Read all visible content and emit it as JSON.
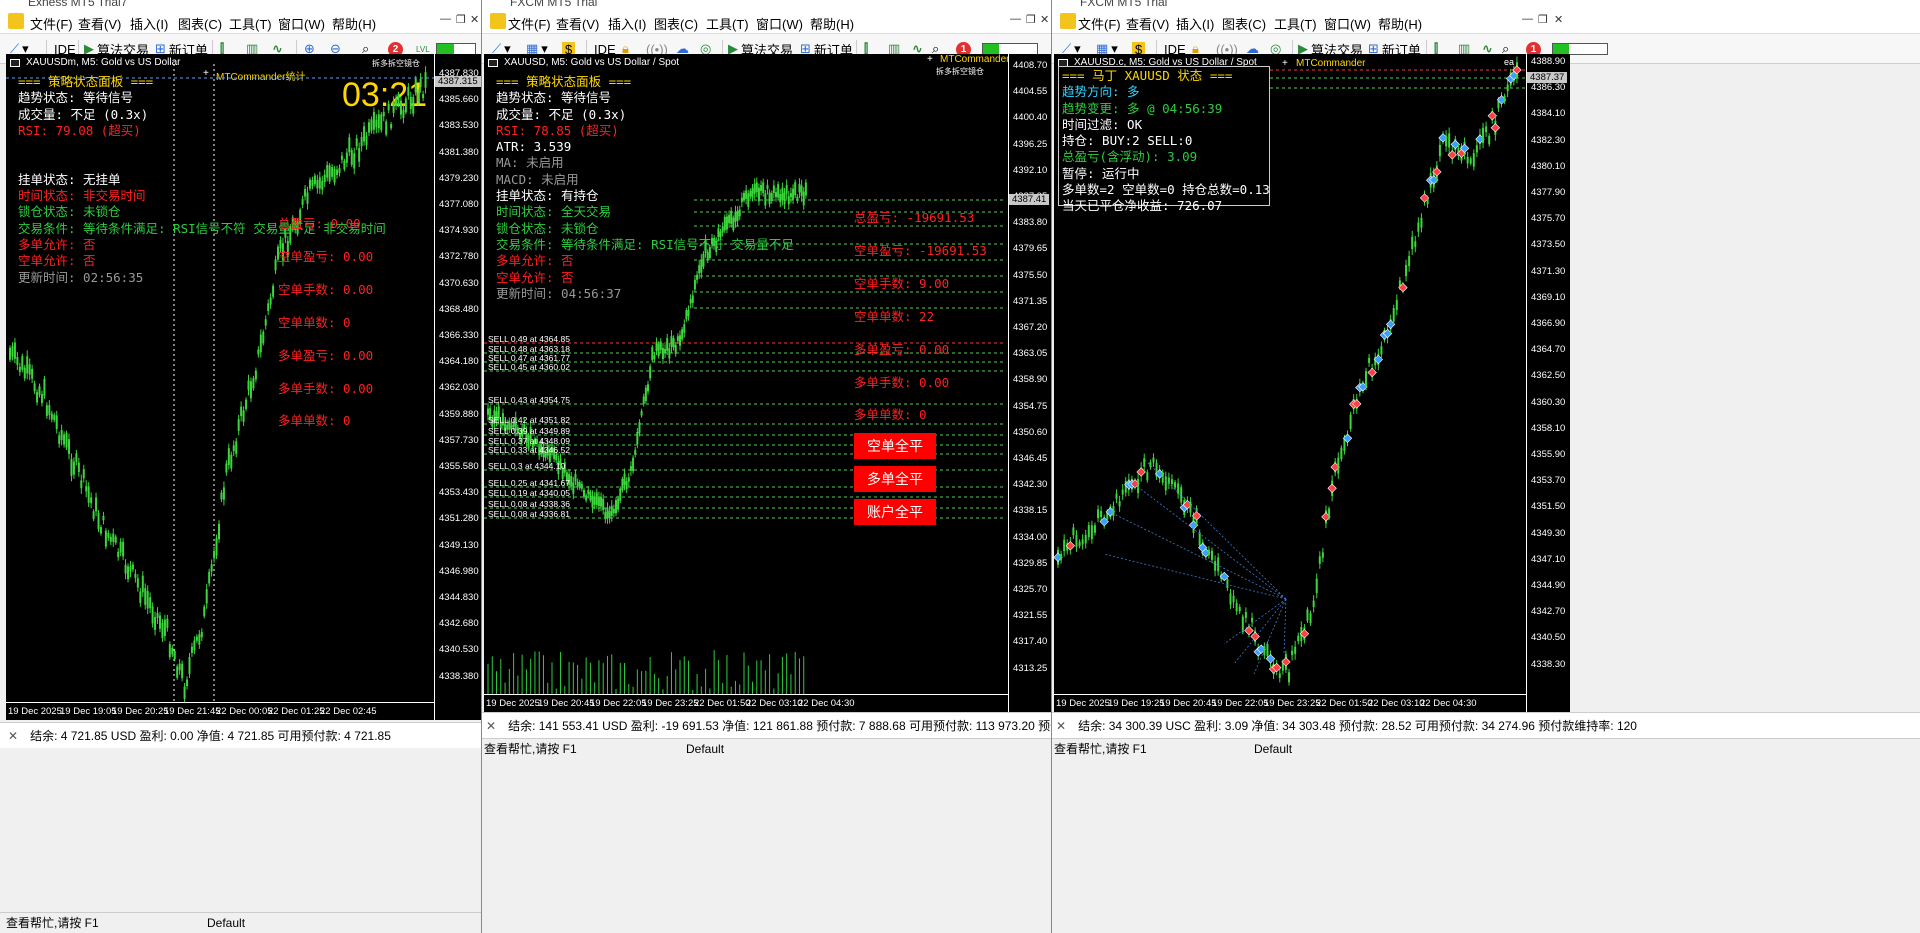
{
  "win1": {
    "title": "Exness MT5 Trial7",
    "menu": [
      "文件(F)",
      "查看(V)",
      "插入(I)",
      "图表(C)",
      "工具(T)",
      "窗口(W)",
      "帮助(H)"
    ],
    "toolbar": {
      "ide": "IDE",
      "algo": "算法交易",
      "neworder": "新订单",
      "badge": "2",
      "lvl": "LVL"
    },
    "chart": {
      "symbol": "XAUUSDm, M5:  Gold vs US Dollar",
      "mtc": "MTCommander统计",
      "corner": "拆多拆空镜仓",
      "clock": "03:21",
      "panel_title": "===  策略状态面板  ===",
      "prices": [
        "4387.830",
        "4385.660",
        "4383.530",
        "4381.380",
        "4379.230",
        "4377.080",
        "4374.930",
        "4372.780",
        "4370.630",
        "4368.480",
        "4366.330",
        "4364.180",
        "4362.030",
        "4359.880",
        "4357.730",
        "4355.580",
        "4353.430",
        "4351.280",
        "4349.130",
        "4346.980",
        "4344.830",
        "4342.680",
        "4340.530",
        "4338.380"
      ],
      "current_price": "4387.315",
      "times": [
        "19 Dec 2025",
        "19 Dec 19:05",
        "19 Dec 20:25",
        "19 Dec 21:45",
        "22 Dec 00:05",
        "22 Dec 01:25",
        "22 Dec 02:45"
      ],
      "lines": [
        {
          "t": "趋势状态:  等待信号",
          "c": "w"
        },
        {
          "t": "成交量:  不足  (0.3x)",
          "c": "w"
        },
        {
          "t": "RSI:  79.08  (超买)",
          "c": "r"
        },
        {
          "t": "",
          "c": "w"
        },
        {
          "t": "",
          "c": "w"
        },
        {
          "t": "挂单状态:  无挂单",
          "c": "w"
        },
        {
          "t": "时间状态:  非交易时间",
          "c": "r"
        },
        {
          "t": "锁仓状态:  未锁仓",
          "c": "gr"
        },
        {
          "t": "交易条件:  等待条件满足:  RSI信号不符  交易量不足  非交易时间",
          "c": "gr"
        },
        {
          "t": "多单允许:  否",
          "c": "r"
        },
        {
          "t": "空单允许:  否",
          "c": "r"
        },
        {
          "t": "更新时间:  02:56:35",
          "c": "gy"
        }
      ],
      "stats": [
        "总盈亏:  0.00",
        "空单盈亏:  0.00",
        "空单手数:  0.00",
        "空单单数:  0",
        "多单盈亏:  0.00",
        "多单手数:  0.00",
        "多单单数:  0"
      ]
    },
    "status": "结余: 4 721.85 USD   盈利: 0.00   净值: 4 721.85   可用预付款: 4 721.85",
    "help": "查看帮忙,请按 F1",
    "profile": "Default"
  },
  "win2": {
    "title": "FXCM MT5 Trial",
    "menu": [
      "文件(F)",
      "查看(V)",
      "插入(I)",
      "图表(C)",
      "工具(T)",
      "窗口(W)",
      "帮助(H)"
    ],
    "toolbar": {
      "ide": "IDE",
      "algo": "算法交易",
      "neworder": "新订单",
      "badge": "1"
    },
    "chart": {
      "symbol": "XAUUSD, M5:  Gold vs US Dollar / Spot",
      "mtc": "MTCommander",
      "corner": "拆多拆空镜仓",
      "panel_title": "===  策略状态面板  ===",
      "prices": [
        "4408.70",
        "4404.55",
        "4400.40",
        "4396.25",
        "4392.10",
        "4387.95",
        "4383.80",
        "4379.65",
        "4375.50",
        "4371.35",
        "4367.20",
        "4363.05",
        "4358.90",
        "4354.75",
        "4350.60",
        "4346.45",
        "4342.30",
        "4338.15",
        "4334.00",
        "4329.85",
        "4325.70",
        "4321.55",
        "4317.40",
        "4313.25"
      ],
      "current_price": "4387.41",
      "times": [
        "19 Dec 2025",
        "19 Dec 20:45",
        "19 Dec 22:05",
        "19 Dec 23:25",
        "22 Dec 01:50",
        "22 Dec 03:10",
        "22 Dec 04:30"
      ],
      "lines": [
        {
          "t": "趋势状态:  等待信号",
          "c": "w"
        },
        {
          "t": "成交量:  不足  (0.3x)",
          "c": "w"
        },
        {
          "t": "RSI:  78.85  (超买)",
          "c": "r"
        },
        {
          "t": "ATR:  3.539",
          "c": "w"
        },
        {
          "t": "MA:  未启用",
          "c": "gy"
        },
        {
          "t": "MACD:  未启用",
          "c": "gy"
        },
        {
          "t": "挂单状态:  有持仓",
          "c": "w"
        },
        {
          "t": "时间状态:  全天交易",
          "c": "gr"
        },
        {
          "t": "锁仓状态:  未锁仓",
          "c": "gr"
        },
        {
          "t": "交易条件:  等待条件满足:  RSI信号不符  交易量不足",
          "c": "gr"
        },
        {
          "t": "多单允许:  否",
          "c": "r"
        },
        {
          "t": "空单允许:  否",
          "c": "r"
        },
        {
          "t": "更新时间:  04:56:37",
          "c": "gy"
        }
      ],
      "stats": [
        "总盈亏:  -19691.53",
        "空单盈亏:  -19691.53",
        "空单手数:  9.00",
        "空单单数:  22",
        "多单盈亏:  0.00",
        "多单手数:  0.00",
        "多单单数:  0"
      ],
      "orders": [
        "SELL 0.49 at 4364.85",
        "SELL 0.48 at 4363.18",
        "SELL 0.47 at 4361.77",
        "SELL 0.45 at 4360.02",
        "SELL 0.43 at 4354.75",
        "SELL 0.42 at 4351.82",
        "SELL 0.39 at 4349.89",
        "SELL 0.37 at 4348.09",
        "SELL 0.33 at 4346.52",
        "SELL 0.3 at 4344.10",
        "SELL 0.25 at 4341.67",
        "SELL 0.19 at 4340.05",
        "SELL 0.08 at 4338.36",
        "SELL 0.08 at 4336.81"
      ],
      "buttons": [
        "空单全平",
        "多单全平",
        "账户全平"
      ]
    },
    "status": "结余: 141 553.41 USD   盈利: -19 691.53   净值: 121 861.88   预付款: 7 888.68   可用预付款: 113 973.20   预付款维持率: 1",
    "help": "查看帮忙,请按 F1",
    "profile": "Default"
  },
  "win3": {
    "title": "FXCM MT5 Trial",
    "menu": [
      "文件(F)",
      "查看(V)",
      "插入(I)",
      "图表(C)",
      "工具(T)",
      "窗口(W)",
      "帮助(H)"
    ],
    "toolbar": {
      "ide": "IDE",
      "algo": "算法交易",
      "neworder": "新订单",
      "badge": "1"
    },
    "chart": {
      "symbol": "XAUUSD.c, M5:  Gold vs US Dollar / Spot",
      "mtc": "MTCommander",
      "corner": "ea",
      "prices": [
        "4388.90",
        "4386.30",
        "4384.10",
        "4382.30",
        "4380.10",
        "4377.90",
        "4375.70",
        "4373.50",
        "4371.30",
        "4369.10",
        "4366.90",
        "4364.70",
        "4362.50",
        "4360.30",
        "4358.10",
        "4355.90",
        "4353.70",
        "4351.50",
        "4349.30",
        "4347.10",
        "4344.90",
        "4342.70",
        "4340.50",
        "4338.30"
      ],
      "current_price": "4387.37",
      "times": [
        "19 Dec 2025",
        "19 Dec 19:25",
        "19 Dec 20:45",
        "19 Dec 22:05",
        "19 Dec 23:25",
        "22 Dec 01:50",
        "22 Dec 03:10",
        "22 Dec 04:30"
      ],
      "panel_title": "===  马丁  XAUUSD  状态  ===",
      "lines": [
        {
          "t": "趋势方向:  多",
          "c": "cy"
        },
        {
          "t": "趋势变更:  多  @  04:56:39",
          "c": "gr"
        },
        {
          "t": "时间过滤:  OK",
          "c": "w"
        },
        {
          "t": "持仓:  BUY:2    SELL:0",
          "c": "w"
        },
        {
          "t": "总盈亏(含浮动):  3.09",
          "c": "gr"
        },
        {
          "t": "暂停:  运行中",
          "c": "w"
        },
        {
          "t": "多单数=2  空单数=0  持仓总数=0.13",
          "c": "w"
        },
        {
          "t": "当天已平仓净收益:  726.07",
          "c": "w"
        }
      ]
    },
    "status": "结余: 34 300.39 USC   盈利: 3.09   净值: 34 303.48   预付款: 28.52   可用预付款: 34 274.96   预付款维持率: 120",
    "help": "查看帮忙,请按 F1",
    "profile": "Default"
  }
}
